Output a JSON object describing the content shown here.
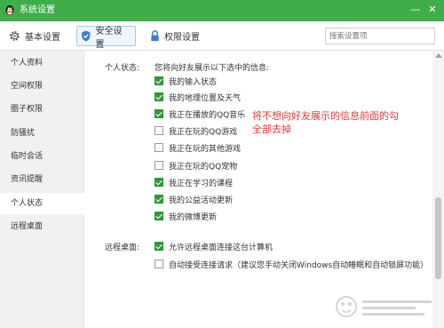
{
  "window": {
    "title": "系统设置",
    "minimize_glyph": "—",
    "close_glyph": "✕"
  },
  "toolbar": {
    "tabs": [
      {
        "label": "基本设置",
        "icon": "gear-icon"
      },
      {
        "label": "安全设置",
        "icon": "shield-icon"
      },
      {
        "label": "权限设置",
        "icon": "lock-icon"
      }
    ],
    "search_placeholder": "搜索设置项"
  },
  "sidebar": {
    "items": [
      {
        "label": "个人资料"
      },
      {
        "label": "空间权限"
      },
      {
        "label": "圈子权限"
      },
      {
        "label": "防骚扰"
      },
      {
        "label": "临时会话"
      },
      {
        "label": "资讯提醒"
      },
      {
        "label": "个人状态"
      },
      {
        "label": "远程桌面"
      }
    ],
    "active_index": 6
  },
  "personal_status": {
    "label": "个人状态:",
    "intro": "您将向好友展示以下选中的信息:",
    "options": [
      {
        "label": "我的输入状态",
        "checked": true
      },
      {
        "label": "我的地理位置及天气",
        "checked": true
      },
      {
        "label": "我正在播放的QQ音乐",
        "checked": true
      },
      {
        "label": "我正在玩的QQ游戏",
        "checked": false
      },
      {
        "label": "我正在玩的其他游戏",
        "checked": false
      },
      {
        "label": "我正在玩的QQ宠物",
        "checked": false
      },
      {
        "label": "我正在学习的课程",
        "checked": true
      },
      {
        "label": "我的公益活动更新",
        "checked": true
      },
      {
        "label": "我的微博更新",
        "checked": true
      }
    ]
  },
  "remote_desktop": {
    "label": "远程桌面:",
    "options": [
      {
        "label": "允许远程桌面连接这台计算机",
        "checked": true
      },
      {
        "label": "自动接受连接请求（建议您手动关闭Windows自动睡眠和自动锁屏功能）",
        "checked": false
      }
    ]
  },
  "annotation": {
    "text": "将不想向好友展示的信息前面的勾全部去掉",
    "color": "#e23a3a"
  },
  "colors": {
    "titlebar": "#3fae4a",
    "checkbox_checked": "#2e9d3a",
    "active_tab_bg": "#eef5fc"
  }
}
